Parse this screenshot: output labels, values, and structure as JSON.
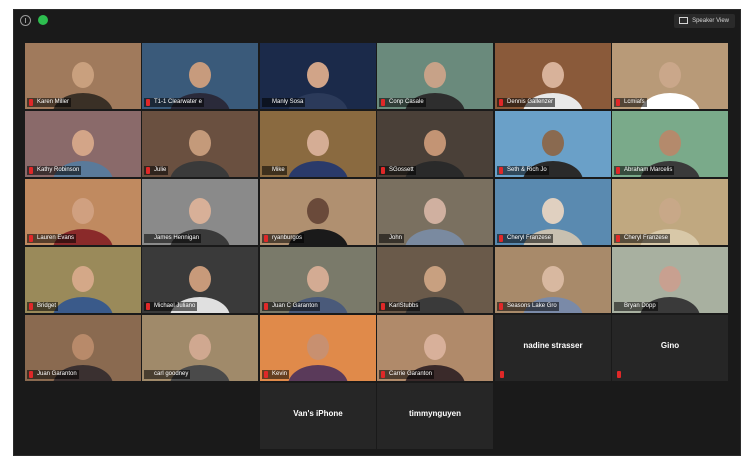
{
  "toolbar": {
    "view_label": "Speaker View"
  },
  "participants": [
    {
      "name": "Karen Miller",
      "bg": "#a07a5c",
      "fg": "#3a3026",
      "skin": "#c9a07e",
      "muted": true
    },
    {
      "name": "T1-1 Clearwater e",
      "bg": "#3a5a7a",
      "fg": "#2a2a3a",
      "skin": "#c79b7d",
      "muted": true,
      "active": true
    },
    {
      "name": "Manly Sosa",
      "bg": "#1b2a4a",
      "fg": "#2b3a5a",
      "skin": "#d1a488",
      "muted": false
    },
    {
      "name": "Conp Casale",
      "bg": "#6a8a7c",
      "fg": "#2e2e2e",
      "skin": "#c7a288",
      "muted": true
    },
    {
      "name": "Dennis Gallenzer",
      "bg": "#8a5a3a",
      "fg": "#e8e8e8",
      "skin": "#d8b29a",
      "muted": true
    },
    {
      "name": "Lcmiafs",
      "bg": "#b89a78",
      "fg": "#ffffff",
      "skin": "#caa78a",
      "muted": true
    },
    {
      "name": "Kathy Robinson",
      "bg": "#8a6a6a",
      "fg": "#5a7a9a",
      "skin": "#d3a588",
      "muted": true
    },
    {
      "name": "Julie",
      "bg": "#6a5040",
      "fg": "#3a3a3a",
      "skin": "#c49a7a",
      "muted": true
    },
    {
      "name": "Mike",
      "bg": "#8a6a40",
      "fg": "#2a3a6a",
      "skin": "#d5ad95",
      "muted": false
    },
    {
      "name": "SGossett",
      "bg": "#4a4038",
      "fg": "#2a2a2a",
      "skin": "#c39474",
      "muted": true
    },
    {
      "name": "Seth & Rich Jo",
      "bg": "#6aa0c8",
      "fg": "#2a2a2a",
      "skin": "#8a6a50",
      "muted": true
    },
    {
      "name": "Abraham Marcelis",
      "bg": "#7aaa8a",
      "fg": "#3a3a3a",
      "skin": "#b48a6c",
      "muted": true
    },
    {
      "name": "Lauren Evans",
      "bg": "#c08a60",
      "fg": "#8a2a2a",
      "skin": "#d0a080",
      "muted": true
    },
    {
      "name": "James Hennigan",
      "bg": "#8a8a8a",
      "fg": "#3a3a3a",
      "skin": "#d8b098",
      "muted": false
    },
    {
      "name": "ryanburgos",
      "bg": "#b09070",
      "fg": "#1a1a1a",
      "skin": "#6a4a3a",
      "muted": true
    },
    {
      "name": "John",
      "bg": "#7a7060",
      "fg": "#7a8aa0",
      "skin": "#d0b0a0",
      "muted": false
    },
    {
      "name": "Cheryl Franzese",
      "bg": "#5a8ab0",
      "fg": "#c8c0b0",
      "skin": "#e0d0c0",
      "muted": true
    },
    {
      "name": "Cheryl Franzese",
      "bg": "#c0a880",
      "fg": "#d8c8a8",
      "skin": "#c8a888",
      "muted": true
    },
    {
      "name": "Bridget",
      "bg": "#9a8a5a",
      "fg": "#3a5a8a",
      "skin": "#d4a888",
      "muted": true
    },
    {
      "name": "Michael Juliano",
      "bg": "#3a3a3a",
      "fg": "#e0e0e0",
      "skin": "#c89a7a",
      "muted": true
    },
    {
      "name": "Juan C Garanton",
      "bg": "#7a7a6a",
      "fg": "#4a5a7a",
      "skin": "#d3ab93",
      "muted": true
    },
    {
      "name": "KarlStubbs",
      "bg": "#6a5a4a",
      "fg": "#3a3a3a",
      "skin": "#c8a080",
      "muted": true
    },
    {
      "name": "Seasons Lake Gro",
      "bg": "#a88a6a",
      "fg": "#7a8aa8",
      "skin": "#d8b8a0",
      "muted": true
    },
    {
      "name": "Bryan Dopp",
      "bg": "#a8b0a0",
      "fg": "#3a3a3a",
      "skin": "#c8a090",
      "muted": false
    },
    {
      "name": "Juan Garanton",
      "bg": "#8a6a50",
      "fg": "#3a3030",
      "skin": "#b88a6a",
      "muted": true
    },
    {
      "name": "carl goodney",
      "bg": "#a08a6a",
      "fg": "#4a4a4a",
      "skin": "#d0a890",
      "muted": false
    },
    {
      "name": "Kevin",
      "bg": "#e08a4a",
      "fg": "#5a3a5a",
      "skin": "#c89070",
      "muted": true
    },
    {
      "name": "Carrie Garanton",
      "bg": "#b08a6a",
      "fg": "#3a2a2a",
      "skin": "#d8b09a",
      "muted": true
    }
  ],
  "blank_participants": [
    {
      "name": "nadine strasser",
      "muted": true
    },
    {
      "name": "Gino",
      "muted": true
    },
    {
      "name": "Van's iPhone",
      "muted": false
    },
    {
      "name": "timmynguyen",
      "muted": false
    }
  ]
}
